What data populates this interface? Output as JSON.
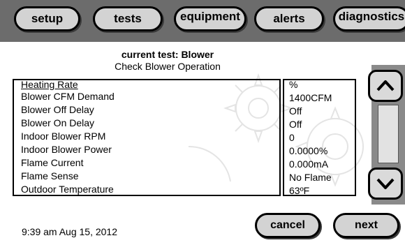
{
  "tabs": {
    "setup": "setup",
    "tests": "tests",
    "equipment": "equipment",
    "alerts": "alerts",
    "diagnostics": "diagnostics"
  },
  "test": {
    "title": "current test: Blower",
    "subtitle": "Check Blower Operation"
  },
  "parameters": [
    {
      "name": "Heating Rate",
      "value": "%"
    },
    {
      "name": "Blower CFM Demand",
      "value": "1400CFM"
    },
    {
      "name": "Blower Off Delay",
      "value": "Off"
    },
    {
      "name": "Blower On Delay",
      "value": "Off"
    },
    {
      "name": "Indoor Blower RPM",
      "value": "0"
    },
    {
      "name": "Indoor Blower Power",
      "value": "0.0000%"
    },
    {
      "name": "Flame Current",
      "value": "0.000mA"
    },
    {
      "name": "Flame Sense",
      "value": "No Flame"
    },
    {
      "name": "Outdoor Temperature",
      "value": "63ºF"
    }
  ],
  "buttons": {
    "cancel": "cancel",
    "next": "next"
  },
  "datetime": "9:39 am Aug 15, 2012",
  "icons": {
    "scroll_up": "chevron-up-icon",
    "scroll_down": "chevron-down-icon",
    "watermark": "gear-watermark-icon"
  },
  "colors": {
    "top_bar": "#6c6c6c",
    "button_fill": "#d3d3d3",
    "scroll_column": "#8a8a8a"
  }
}
